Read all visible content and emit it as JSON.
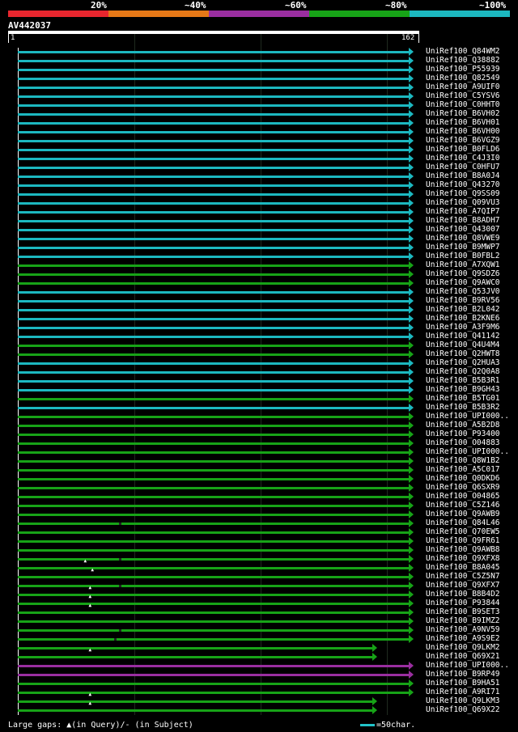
{
  "legend": {
    "labels": [
      "20%",
      "~40%",
      "~60%",
      "~80%",
      "~100%"
    ],
    "colors": [
      "#e8262e",
      "#e67817",
      "#9a2ea0",
      "#17a317",
      "#1cb8c0"
    ]
  },
  "query": {
    "name": "AV442037",
    "start_label": "1",
    "end_label": "162",
    "length": 162
  },
  "hits": [
    {
      "name": "UniRef100_Q84WM2",
      "color": "cyan",
      "end": 162
    },
    {
      "name": "UniRef100_Q38882",
      "color": "cyan",
      "end": 162
    },
    {
      "name": "UniRef100_P55939",
      "color": "cyan",
      "end": 162
    },
    {
      "name": "UniRef100_Q82549",
      "color": "cyan",
      "end": 162
    },
    {
      "name": "UniRef100_A9UIF0",
      "color": "cyan",
      "end": 162
    },
    {
      "name": "UniRef100_C5YSV6",
      "color": "cyan",
      "end": 162
    },
    {
      "name": "UniRef100_C0HHT0",
      "color": "cyan",
      "end": 162
    },
    {
      "name": "UniRef100_B6VH02",
      "color": "cyan",
      "end": 162
    },
    {
      "name": "UniRef100_B6VH01",
      "color": "cyan",
      "end": 162
    },
    {
      "name": "UniRef100_B6VH00",
      "color": "cyan",
      "end": 162
    },
    {
      "name": "UniRef100_B6VGZ9",
      "color": "cyan",
      "end": 162
    },
    {
      "name": "UniRef100_B0FLD6",
      "color": "cyan",
      "end": 162
    },
    {
      "name": "UniRef100_C4J3I0",
      "color": "cyan",
      "end": 162
    },
    {
      "name": "UniRef100_C0HFU7",
      "color": "cyan",
      "end": 162
    },
    {
      "name": "UniRef100_B8A0J4",
      "color": "cyan",
      "end": 162
    },
    {
      "name": "UniRef100_Q43270",
      "color": "cyan",
      "end": 162
    },
    {
      "name": "UniRef100_Q9SS09",
      "color": "cyan",
      "end": 162
    },
    {
      "name": "UniRef100_Q09VU3",
      "color": "cyan",
      "end": 162
    },
    {
      "name": "UniRef100_A7QIP7",
      "color": "cyan",
      "end": 162
    },
    {
      "name": "UniRef100_B8ADH7",
      "color": "cyan",
      "end": 162
    },
    {
      "name": "UniRef100_Q43007",
      "color": "cyan",
      "end": 162
    },
    {
      "name": "UniRef100_Q8VWE9",
      "color": "cyan",
      "end": 162
    },
    {
      "name": "UniRef100_B9MWP7",
      "color": "cyan",
      "end": 162
    },
    {
      "name": "UniRef100_B0FBL2",
      "color": "cyan",
      "end": 162
    },
    {
      "name": "UniRef100_A7XQW1",
      "color": "green",
      "end": 162
    },
    {
      "name": "UniRef100_Q9SDZ6",
      "color": "green",
      "end": 162
    },
    {
      "name": "UniRef100_Q9AWC0",
      "color": "green",
      "end": 162
    },
    {
      "name": "UniRef100_Q53JV0",
      "color": "cyan",
      "end": 162
    },
    {
      "name": "UniRef100_B9RV56",
      "color": "cyan",
      "end": 162
    },
    {
      "name": "UniRef100_B2L042",
      "color": "cyan",
      "end": 162
    },
    {
      "name": "UniRef100_B2KNE6",
      "color": "cyan",
      "end": 162
    },
    {
      "name": "UniRef100_A3F9M6",
      "color": "cyan",
      "end": 162
    },
    {
      "name": "UniRef100_Q41142",
      "color": "cyan",
      "end": 162
    },
    {
      "name": "UniRef100_Q4U4M4",
      "color": "green",
      "end": 162
    },
    {
      "name": "UniRef100_Q2HWT8",
      "color": "green",
      "end": 162
    },
    {
      "name": "UniRef100_Q2HUA3",
      "color": "cyan",
      "end": 162
    },
    {
      "name": "UniRef100_Q2Q0A8",
      "color": "cyan",
      "end": 162
    },
    {
      "name": "UniRef100_B5B3R1",
      "color": "cyan",
      "end": 162
    },
    {
      "name": "UniRef100_B9GH43",
      "color": "cyan",
      "end": 162
    },
    {
      "name": "UniRef100_B5TG01",
      "color": "green",
      "end": 162
    },
    {
      "name": "UniRef100_B5B3R2",
      "color": "cyan",
      "end": 162
    },
    {
      "name": "UniRef100_UPI000..",
      "color": "green",
      "end": 162
    },
    {
      "name": "UniRef100_A5B2D8",
      "color": "green",
      "end": 162
    },
    {
      "name": "UniRef100_P93400",
      "color": "green",
      "end": 162
    },
    {
      "name": "UniRef100_O04883",
      "color": "green",
      "end": 162
    },
    {
      "name": "UniRef100_UPI000..",
      "color": "green",
      "end": 162
    },
    {
      "name": "UniRef100_Q8W1B2",
      "color": "green",
      "end": 162
    },
    {
      "name": "UniRef100_A5C017",
      "color": "green",
      "end": 162
    },
    {
      "name": "UniRef100_Q0DKD6",
      "color": "green",
      "end": 162
    },
    {
      "name": "UniRef100_Q6SXR9",
      "color": "green",
      "end": 162
    },
    {
      "name": "UniRef100_O04865",
      "color": "green",
      "end": 162
    },
    {
      "name": "UniRef100_C5Z146",
      "color": "green",
      "end": 162
    },
    {
      "name": "UniRef100_Q9AWB9",
      "color": "green",
      "end": 162
    },
    {
      "name": "UniRef100_Q84L46",
      "color": "green",
      "end": 162,
      "dash": 42
    },
    {
      "name": "UniRef100_Q70EW5",
      "color": "green",
      "end": 162
    },
    {
      "name": "UniRef100_Q9FR61",
      "color": "green",
      "end": 162
    },
    {
      "name": "UniRef100_Q9AWB8",
      "color": "green",
      "end": 162
    },
    {
      "name": "UniRef100_Q9XFX8",
      "color": "green",
      "end": 162,
      "dash": 42
    },
    {
      "name": "UniRef100_B8A045",
      "color": "green",
      "end": 162,
      "gap": 28
    },
    {
      "name": "UniRef100_C5Z5N7",
      "color": "green",
      "end": 162,
      "gap": 31
    },
    {
      "name": "UniRef100_Q9XFX7",
      "color": "green",
      "end": 162,
      "dash": 42
    },
    {
      "name": "UniRef100_B8B4D2",
      "color": "green",
      "end": 162,
      "gap": 30
    },
    {
      "name": "UniRef100_P93844",
      "color": "green",
      "end": 162,
      "gap": 30
    },
    {
      "name": "UniRef100_B9SET3",
      "color": "green",
      "end": 162,
      "gap": 30
    },
    {
      "name": "UniRef100_B9IMZ2",
      "color": "green",
      "end": 162
    },
    {
      "name": "UniRef100_A9NV59",
      "color": "green",
      "end": 162,
      "dash": 42
    },
    {
      "name": "UniRef100_A9S9E2",
      "color": "green",
      "end": 162,
      "dash": 40
    },
    {
      "name": "UniRef100_Q9LKM2",
      "color": "green",
      "end": 147
    },
    {
      "name": "UniRef100_Q69X21",
      "color": "green",
      "end": 147,
      "gap": 30
    },
    {
      "name": "UniRef100_UPI000..",
      "color": "purple",
      "end": 162
    },
    {
      "name": "UniRef100_B9RP49",
      "color": "purple",
      "end": 162
    },
    {
      "name": "UniRef100_B9HA51",
      "color": "green",
      "end": 162
    },
    {
      "name": "UniRef100_A9RI71",
      "color": "green",
      "end": 162
    },
    {
      "name": "UniRef100_Q9LKM3",
      "color": "green",
      "end": 147,
      "gap": 30
    },
    {
      "name": "UniRef100_Q69X22",
      "color": "green",
      "end": 147,
      "gap": 30
    }
  ],
  "footer": {
    "gaps_text": "Large gaps: ▲(in Query)/- (in Subject)",
    "scale_text": "=50char."
  }
}
